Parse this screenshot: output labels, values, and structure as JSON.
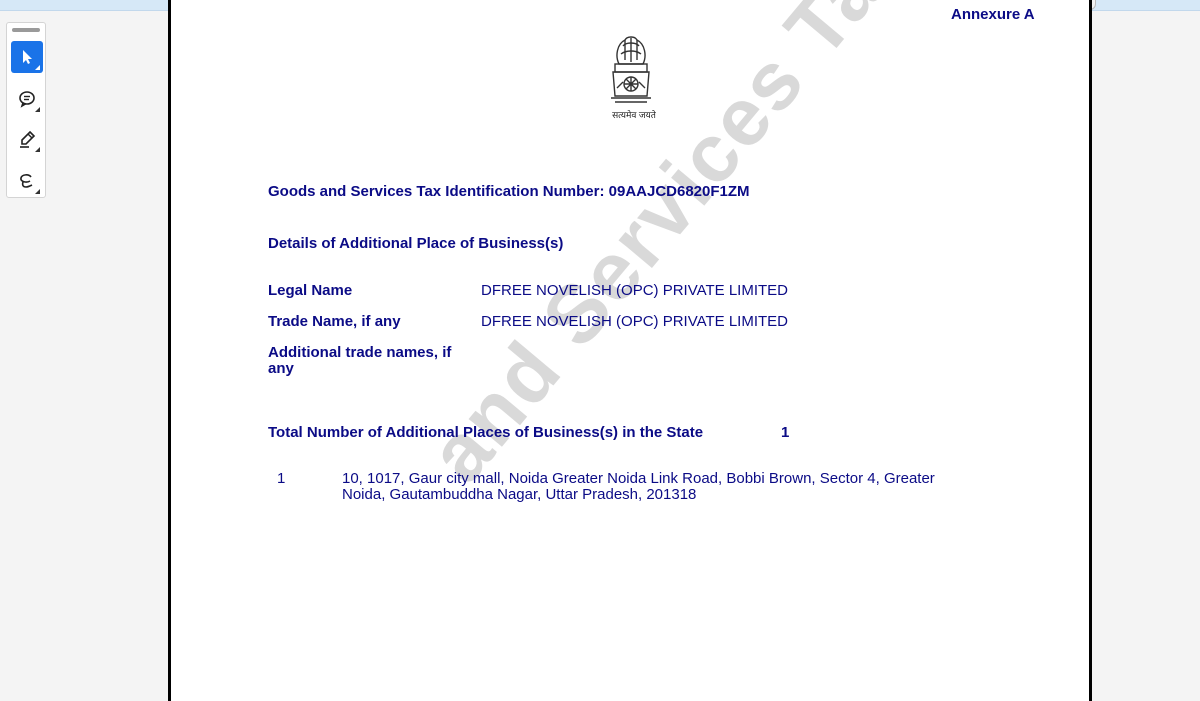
{
  "document": {
    "annexure": "Annexure A",
    "motto": "सत्यमेव जयते",
    "watermark": "and Services Tax",
    "gstin_label": "Goods and Services Tax Identification Number:",
    "gstin_value": "09AAJCD6820F1ZM",
    "section_title": "Details of Additional Place of Business(s)",
    "fields": {
      "legal_name_label": "Legal Name",
      "legal_name_value": "DFREE NOVELISH (OPC) PRIVATE LIMITED",
      "trade_name_label": "Trade Name, if any",
      "trade_name_value": "DFREE NOVELISH (OPC) PRIVATE LIMITED",
      "additional_trade_label_line1": "Additional trade names, if",
      "additional_trade_label_line2": "any"
    },
    "total_label": "Total Number of Additional Places of Business(s) in the State",
    "total_value": "1",
    "places": [
      {
        "index": "1",
        "address_line1": "10, 1017, Gaur city mall, Noida Greater Noida Link Road, Bobbi Brown, Sector 4, Greater",
        "address_line2": "Noida, Gautambuddha Nagar, Uttar Pradesh, 201318"
      }
    ]
  },
  "toolbar": {
    "tools": [
      "select-cursor-icon",
      "comment-icon",
      "highlight-pen-icon",
      "draw-lasso-icon"
    ]
  },
  "colors": {
    "text": "#0b0b86",
    "accent": "#1a73e8",
    "watermark": "#d9d9d9"
  }
}
